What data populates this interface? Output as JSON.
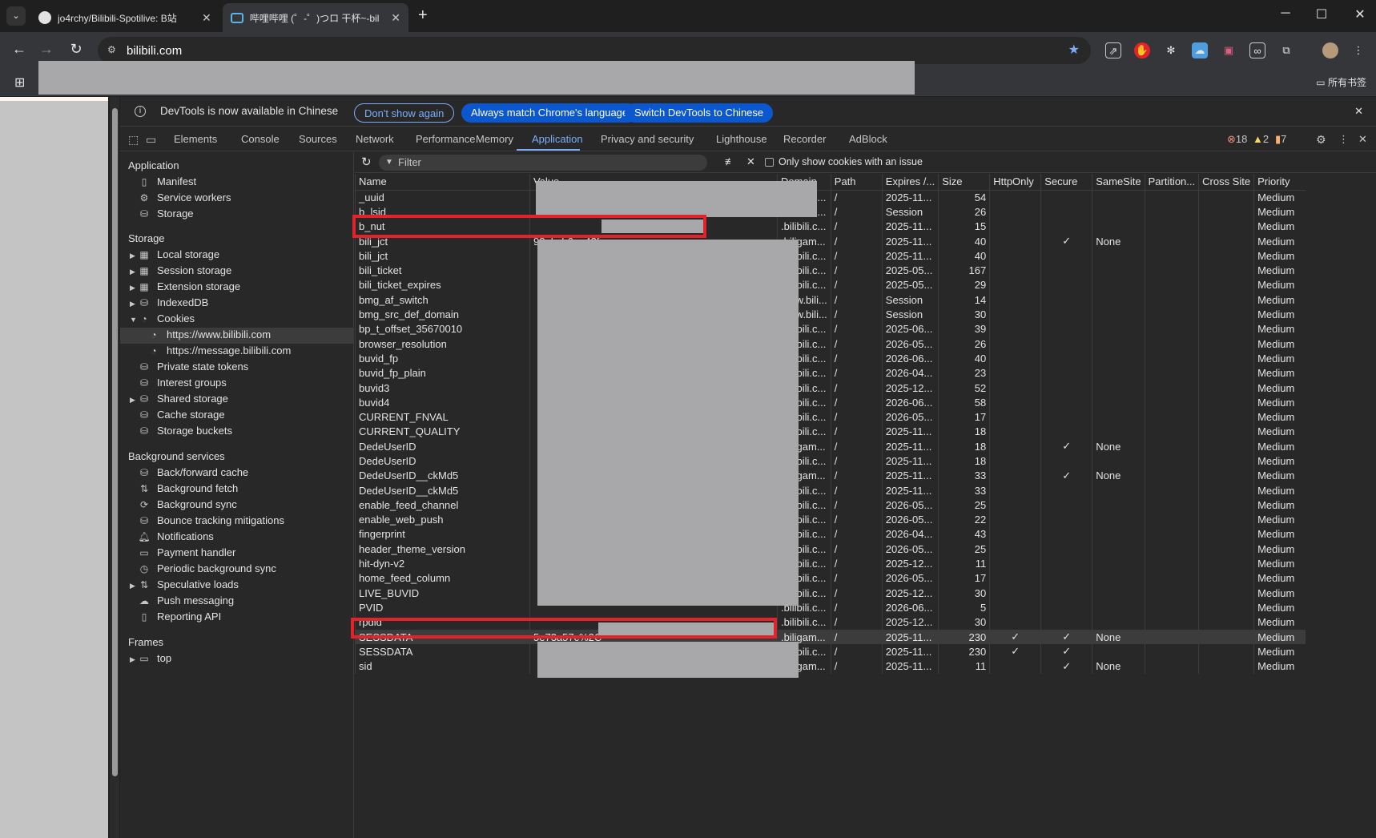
{
  "browser": {
    "tabs": [
      {
        "title": "jo4rchy/Bilibili-Spotilive: B站",
        "icon": "github-icon"
      },
      {
        "title": "哔哩哔哩 (゜-゜)つロ 干杯~-bil",
        "icon": "bilibili-tv-icon"
      }
    ],
    "url": "bilibili.com",
    "bookmarks_all": "所有书签"
  },
  "devtools": {
    "infobar": {
      "message": "DevTools is now available in Chinese",
      "btn_dont_show": "Don't show again",
      "btn_match": "Always match Chrome's language",
      "btn_switch": "Switch DevTools to Chinese"
    },
    "tabs": [
      "Elements",
      "Console",
      "Sources",
      "Network",
      "Performance",
      "Memory",
      "Application",
      "Privacy and security",
      "Lighthouse",
      "Recorder",
      "AdBlock"
    ],
    "counts": {
      "errors": "18",
      "warnings": "2",
      "issues": "7"
    },
    "sidebar": {
      "application_head": "Application",
      "application": [
        "Manifest",
        "Service workers",
        "Storage"
      ],
      "storage_head": "Storage",
      "storage": [
        "Local storage",
        "Session storage",
        "Extension storage",
        "IndexedDB",
        "Cookies"
      ],
      "cookie_origins": [
        "https://www.bilibili.com",
        "https://message.bilibili.com"
      ],
      "storage2": [
        "Private state tokens",
        "Interest groups",
        "Shared storage",
        "Cache storage",
        "Storage buckets"
      ],
      "bg_head": "Background services",
      "bg": [
        "Back/forward cache",
        "Background fetch",
        "Background sync",
        "Bounce tracking mitigations",
        "Notifications",
        "Payment handler",
        "Periodic background sync",
        "Speculative loads",
        "Push messaging",
        "Reporting API"
      ],
      "frames_head": "Frames",
      "frames": [
        "top"
      ]
    },
    "filter": {
      "placeholder": "Filter",
      "only_issue": "Only show cookies with an issue"
    },
    "columns": [
      "Name",
      "Value",
      "Domain",
      "Path",
      "Expires /...",
      "Size",
      "HttpOnly",
      "Secure",
      "SameSite",
      "Partition...",
      "Cross Site",
      "Priority"
    ],
    "rows": [
      {
        "name": "_uuid",
        "value": "",
        "domain": ".bilibili.c...",
        "path": "/",
        "expires": "2025-11...",
        "size": "54",
        "httponly": "",
        "secure": "",
        "samesite": "",
        "priority": "Medium"
      },
      {
        "name": "b_lsid",
        "value": "",
        "domain": ".bilibili.c...",
        "path": "/",
        "expires": "Session",
        "size": "26",
        "httponly": "",
        "secure": "",
        "samesite": "",
        "priority": "Medium"
      },
      {
        "name": "b_nut",
        "value": "",
        "domain": ".bilibili.c...",
        "path": "/",
        "expires": "2025-11...",
        "size": "15",
        "httponly": "",
        "secure": "",
        "samesite": "",
        "priority": "Medium"
      },
      {
        "name": "bili_jct",
        "value": "98ebcb6ae42f",
        "domain": ".biligam...",
        "path": "/",
        "expires": "2025-11...",
        "size": "40",
        "httponly": "",
        "secure": "✓",
        "samesite": "None",
        "priority": "Medium"
      },
      {
        "name": "bili_jct",
        "value": "",
        "domain": ".bilibili.c...",
        "path": "/",
        "expires": "2025-11...",
        "size": "40",
        "httponly": "",
        "secure": "",
        "samesite": "",
        "priority": "Medium"
      },
      {
        "name": "bili_ticket",
        "value": "",
        "domain": ".bilibili.c...",
        "path": "/",
        "expires": "2025-05...",
        "size": "167",
        "httponly": "",
        "secure": "",
        "samesite": "",
        "priority": "Medium"
      },
      {
        "name": "bili_ticket_expires",
        "value": "",
        "domain": ".bilibili.c...",
        "path": "/",
        "expires": "2025-05...",
        "size": "29",
        "httponly": "",
        "secure": "",
        "samesite": "",
        "priority": "Medium"
      },
      {
        "name": "bmg_af_switch",
        "value": "",
        "domain": "www.bili...",
        "path": "/",
        "expires": "Session",
        "size": "14",
        "httponly": "",
        "secure": "",
        "samesite": "",
        "priority": "Medium"
      },
      {
        "name": "bmg_src_def_domain",
        "value": "",
        "domain": "www.bili...",
        "path": "/",
        "expires": "Session",
        "size": "30",
        "httponly": "",
        "secure": "",
        "samesite": "",
        "priority": "Medium"
      },
      {
        "name": "bp_t_offset_35670010",
        "value": "",
        "domain": ".bilibili.c...",
        "path": "/",
        "expires": "2025-06...",
        "size": "39",
        "httponly": "",
        "secure": "",
        "samesite": "",
        "priority": "Medium"
      },
      {
        "name": "browser_resolution",
        "value": "",
        "domain": ".bilibili.c...",
        "path": "/",
        "expires": "2026-05...",
        "size": "26",
        "httponly": "",
        "secure": "",
        "samesite": "",
        "priority": "Medium"
      },
      {
        "name": "buvid_fp",
        "value": "",
        "domain": ".bilibili.c...",
        "path": "/",
        "expires": "2026-06...",
        "size": "40",
        "httponly": "",
        "secure": "",
        "samesite": "",
        "priority": "Medium"
      },
      {
        "name": "buvid_fp_plain",
        "value": "",
        "domain": ".bilibili.c...",
        "path": "/",
        "expires": "2026-04...",
        "size": "23",
        "httponly": "",
        "secure": "",
        "samesite": "",
        "priority": "Medium"
      },
      {
        "name": "buvid3",
        "value": "",
        "domain": ".bilibili.c...",
        "path": "/",
        "expires": "2025-12...",
        "size": "52",
        "httponly": "",
        "secure": "",
        "samesite": "",
        "priority": "Medium"
      },
      {
        "name": "buvid4",
        "value": "",
        "domain": ".bilibili.c...",
        "path": "/",
        "expires": "2026-06...",
        "size": "58",
        "httponly": "",
        "secure": "",
        "samesite": "",
        "priority": "Medium"
      },
      {
        "name": "CURRENT_FNVAL",
        "value": "",
        "domain": ".bilibili.c...",
        "path": "/",
        "expires": "2026-05...",
        "size": "17",
        "httponly": "",
        "secure": "",
        "samesite": "",
        "priority": "Medium"
      },
      {
        "name": "CURRENT_QUALITY",
        "value": "",
        "domain": ".bilibili.c...",
        "path": "/",
        "expires": "2025-11...",
        "size": "18",
        "httponly": "",
        "secure": "",
        "samesite": "",
        "priority": "Medium"
      },
      {
        "name": "DedeUserID",
        "value": "",
        "domain": ".biligam...",
        "path": "/",
        "expires": "2025-11...",
        "size": "18",
        "httponly": "",
        "secure": "✓",
        "samesite": "None",
        "priority": "Medium"
      },
      {
        "name": "DedeUserID",
        "value": "",
        "domain": ".bilibili.c...",
        "path": "/",
        "expires": "2025-11...",
        "size": "18",
        "httponly": "",
        "secure": "",
        "samesite": "",
        "priority": "Medium"
      },
      {
        "name": "DedeUserID__ckMd5",
        "value": "",
        "domain": ".biligam...",
        "path": "/",
        "expires": "2025-11...",
        "size": "33",
        "httponly": "",
        "secure": "✓",
        "samesite": "None",
        "priority": "Medium"
      },
      {
        "name": "DedeUserID__ckMd5",
        "value": "",
        "domain": ".bilibili.c...",
        "path": "/",
        "expires": "2025-11...",
        "size": "33",
        "httponly": "",
        "secure": "",
        "samesite": "",
        "priority": "Medium"
      },
      {
        "name": "enable_feed_channel",
        "value": "",
        "domain": ".bilibili.c...",
        "path": "/",
        "expires": "2026-05...",
        "size": "25",
        "httponly": "",
        "secure": "",
        "samesite": "",
        "priority": "Medium"
      },
      {
        "name": "enable_web_push",
        "value": "",
        "domain": ".bilibili.c...",
        "path": "/",
        "expires": "2026-05...",
        "size": "22",
        "httponly": "",
        "secure": "",
        "samesite": "",
        "priority": "Medium"
      },
      {
        "name": "fingerprint",
        "value": "",
        "domain": ".bilibili.c...",
        "path": "/",
        "expires": "2026-04...",
        "size": "43",
        "httponly": "",
        "secure": "",
        "samesite": "",
        "priority": "Medium"
      },
      {
        "name": "header_theme_version",
        "value": "",
        "domain": ".bilibili.c...",
        "path": "/",
        "expires": "2026-05...",
        "size": "25",
        "httponly": "",
        "secure": "",
        "samesite": "",
        "priority": "Medium"
      },
      {
        "name": "hit-dyn-v2",
        "value": "",
        "domain": ".bilibili.c...",
        "path": "/",
        "expires": "2025-12...",
        "size": "11",
        "httponly": "",
        "secure": "",
        "samesite": "",
        "priority": "Medium"
      },
      {
        "name": "home_feed_column",
        "value": "",
        "domain": ".bilibili.c...",
        "path": "/",
        "expires": "2026-05...",
        "size": "17",
        "httponly": "",
        "secure": "",
        "samesite": "",
        "priority": "Medium"
      },
      {
        "name": "LIVE_BUVID",
        "value": "",
        "domain": ".bilibili.c...",
        "path": "/",
        "expires": "2025-12...",
        "size": "30",
        "httponly": "",
        "secure": "",
        "samesite": "",
        "priority": "Medium"
      },
      {
        "name": "PVID",
        "value": "",
        "domain": ".bilibili.c...",
        "path": "/",
        "expires": "2026-06...",
        "size": "5",
        "httponly": "",
        "secure": "",
        "samesite": "",
        "priority": "Medium"
      },
      {
        "name": "rpdid",
        "value": "",
        "domain": ".bilibili.c...",
        "path": "/",
        "expires": "2025-12...",
        "size": "30",
        "httponly": "",
        "secure": "",
        "samesite": "",
        "priority": "Medium"
      },
      {
        "name": "SESSDATA",
        "value": "5e73a57c%2C",
        "domain": ".biligam...",
        "path": "/",
        "expires": "2025-11...",
        "size": "230",
        "httponly": "✓",
        "secure": "✓",
        "samesite": "None",
        "priority": "Medium"
      },
      {
        "name": "SESSDATA",
        "value": "",
        "domain": ".bilibili.c...",
        "path": "/",
        "expires": "2025-11...",
        "size": "230",
        "httponly": "✓",
        "secure": "✓",
        "samesite": "",
        "priority": "Medium"
      },
      {
        "name": "sid",
        "value": "",
        "domain": ".biligam...",
        "path": "/",
        "expires": "2025-11...",
        "size": "11",
        "httponly": "",
        "secure": "✓",
        "samesite": "None",
        "priority": "Medium"
      }
    ],
    "selected_row": 30
  },
  "colors": {
    "accent": "#7cacf8",
    "highlight": "#e3222a",
    "redaction": "#a8a8aa"
  }
}
